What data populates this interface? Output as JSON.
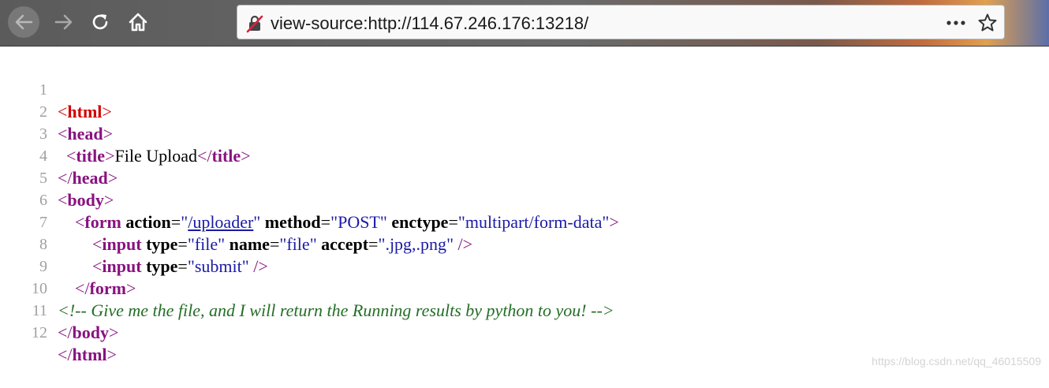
{
  "browser": {
    "url": "view-source:http://114.67.246.176:13218/"
  },
  "source": {
    "lines": [
      {
        "n": "1"
      },
      {
        "n": "2"
      },
      {
        "n": "3"
      },
      {
        "n": "4"
      },
      {
        "n": "5"
      },
      {
        "n": "6"
      },
      {
        "n": "7"
      },
      {
        "n": "8"
      },
      {
        "n": "9"
      },
      {
        "n": "10"
      },
      {
        "n": "11"
      },
      {
        "n": "12"
      }
    ],
    "t": {
      "html": "html",
      "head": "head",
      "title": "title",
      "body": "body",
      "form": "form",
      "input": "input",
      "action": "action",
      "method": "method",
      "enctype": "enctype",
      "type": "type",
      "name": "name",
      "accept": "accept",
      "v_uploader": "/uploader",
      "v_post": "POST",
      "v_multipart": "multipart/form-data",
      "v_file": "file",
      "v_file2": "file",
      "v_accept": ".jpg,.png",
      "v_submit": "submit",
      "title_text": "File Upload",
      "comment": "<!-- Give me the file, and I will return the Running results by python to you! -->"
    }
  },
  "watermark": "https://blog.csdn.net/qq_46015509"
}
